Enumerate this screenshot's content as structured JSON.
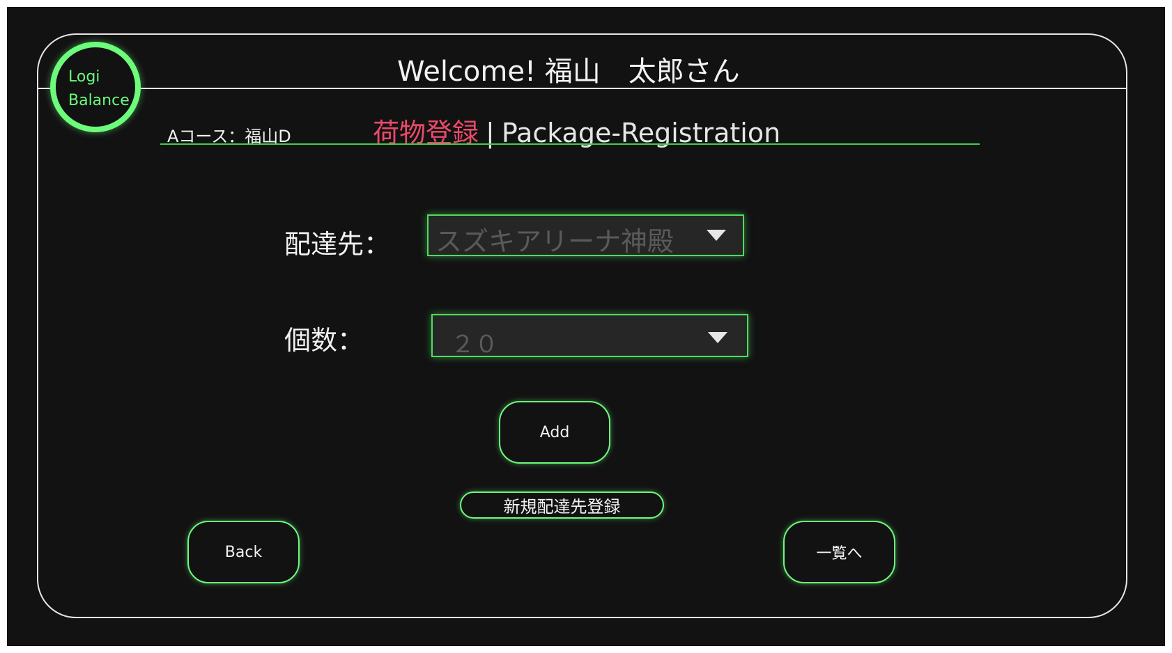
{
  "header": {
    "welcome": "Welcome! 福山　太郎さん"
  },
  "logo": {
    "line1": "Logi",
    "line2": "Balance"
  },
  "course": "Aコース：福山D",
  "page_title": {
    "jp": "荷物登録",
    "separator": "|",
    "en": "Package-Registration"
  },
  "form": {
    "destination_label": "配達先：",
    "destination_value": "スズキアリーナ神殿",
    "count_label": "個数：",
    "count_value": "２０"
  },
  "buttons": {
    "add": "Add",
    "new_destination": "新規配達先登録",
    "back": "Back",
    "to_list": "一覧へ"
  },
  "colors": {
    "background": "#121212",
    "accent_green": "#6cfb7b",
    "title_pink": "#ea4a6a",
    "frame": "#e6e6e6"
  },
  "icons": {
    "dropdown": "caret-down-icon"
  }
}
